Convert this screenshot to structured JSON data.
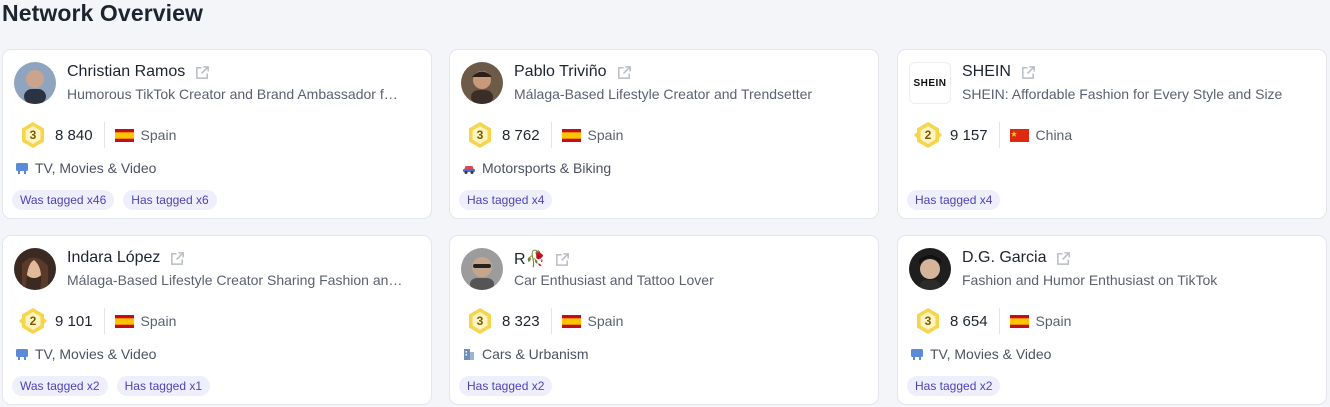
{
  "page": {
    "title": "Network Overview"
  },
  "cards": [
    {
      "name": "Christian Ramos",
      "description": "Humorous TikTok Creator and Brand Ambassador f…",
      "level": "3",
      "score": "8 840",
      "country": "Spain",
      "category": "TV, Movies & Video",
      "category_icon": "tv-icon",
      "tags": [
        "Was tagged x46",
        "Has tagged x6"
      ]
    },
    {
      "name": "Pablo Triviño",
      "description": "Málaga-Based Lifestyle Creator and Trendsetter",
      "level": "3",
      "score": "8 762",
      "country": "Spain",
      "category": "Motorsports & Biking",
      "category_icon": "car-icon",
      "tags": [
        "Has tagged x4"
      ]
    },
    {
      "name": "SHEIN",
      "logo_text": "SHEIN",
      "description": "SHEIN: Affordable Fashion for Every Style and Size",
      "level": "2",
      "score": "9 157",
      "country": "China",
      "category": "",
      "category_icon": "",
      "tags": [
        "Has tagged x4"
      ]
    },
    {
      "name": "Indara López",
      "description": "Málaga-Based Lifestyle Creator Sharing Fashion an…",
      "level": "2",
      "score": "9 101",
      "country": "Spain",
      "category": "TV, Movies & Video",
      "category_icon": "tv-icon",
      "tags": [
        "Was tagged x2",
        "Has tagged x1"
      ]
    },
    {
      "name": "R🥀",
      "description": "Car Enthusiast and Tattoo Lover",
      "level": "3",
      "score": "8 323",
      "country": "Spain",
      "category": "Cars & Urbanism",
      "category_icon": "building-icon",
      "tags": [
        "Has tagged x2"
      ]
    },
    {
      "name": "D.G. Garcia",
      "description": "Fashion and Humor Enthusiast on TikTok",
      "level": "3",
      "score": "8 654",
      "country": "Spain",
      "category": "TV, Movies & Video",
      "category_icon": "tv-icon",
      "tags": [
        "Has tagged x2"
      ]
    }
  ],
  "colors": {
    "tag_bg": "#efeefc",
    "tag_text": "#4e43b8",
    "badge_gold": "#f5c542"
  }
}
